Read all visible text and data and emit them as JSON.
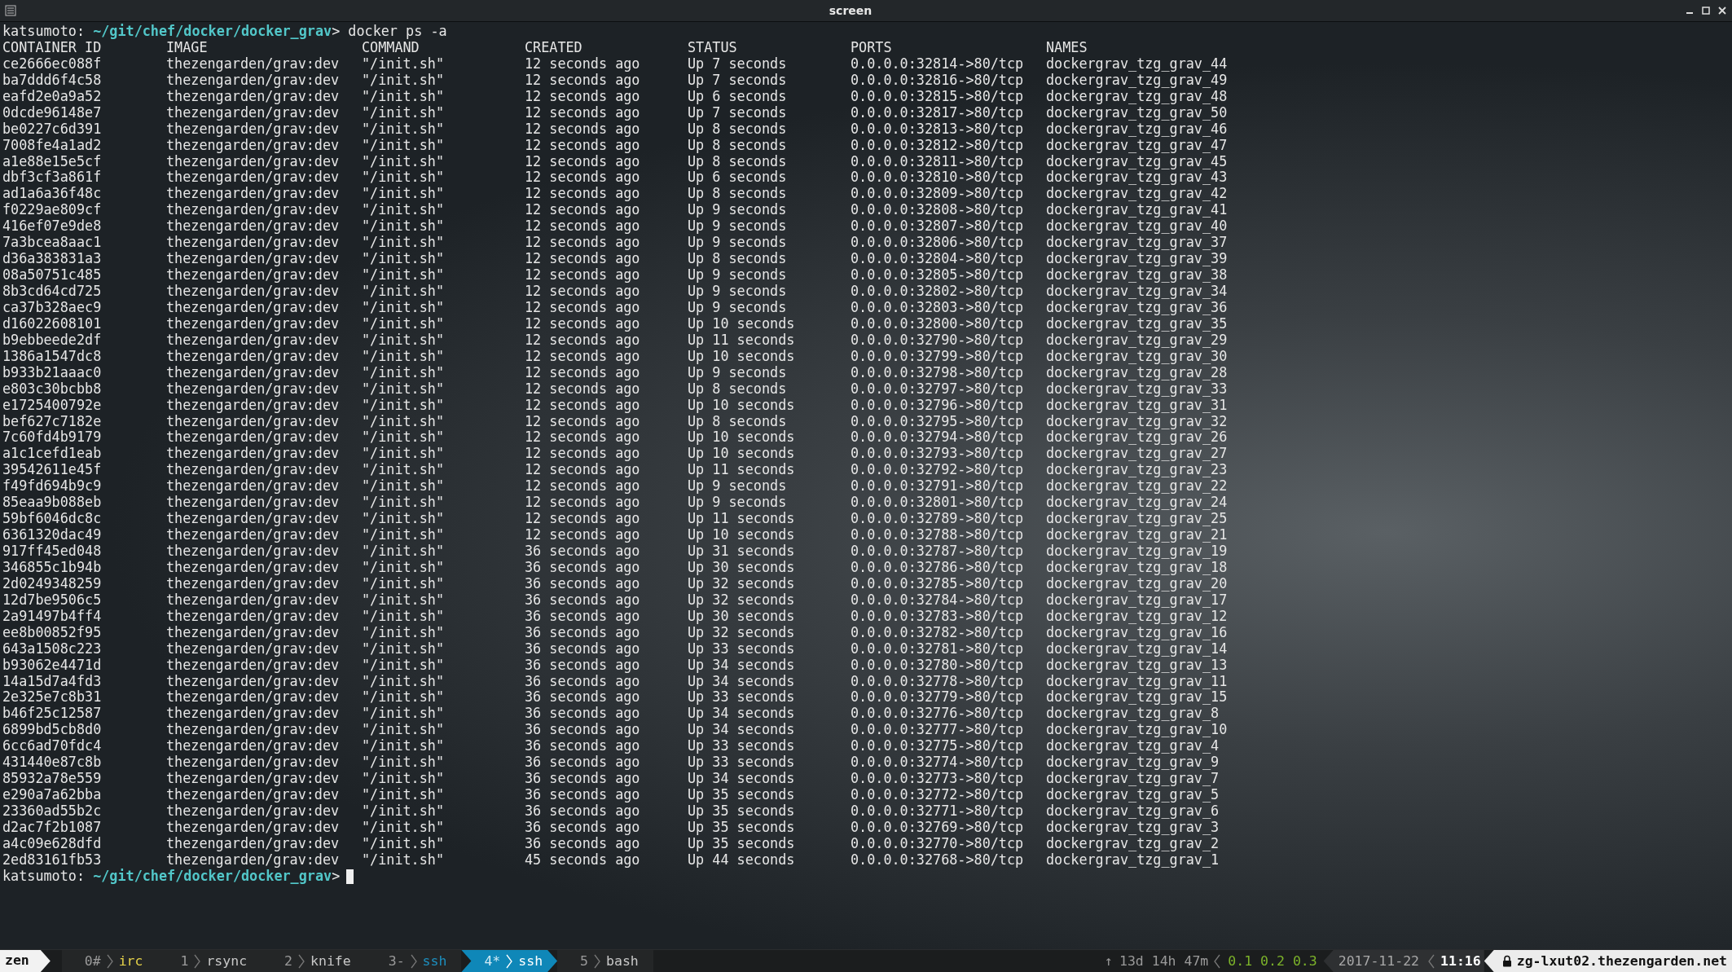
{
  "window": {
    "title": "screen"
  },
  "prompt": {
    "user": "katsumoto:",
    "path": "~/git/chef/docker/docker_grav",
    "symbol": ">",
    "command": "docker ps -a"
  },
  "table": {
    "columns": [
      "CONTAINER ID",
      "IMAGE",
      "COMMAND",
      "CREATED",
      "STATUS",
      "PORTS",
      "NAMES"
    ],
    "rows": [
      [
        "ce2666ec088f",
        "thezengarden/grav:dev",
        "\"/init.sh\"",
        "12 seconds ago",
        "Up 7 seconds",
        "0.0.0.0:32814->80/tcp",
        "dockergrav_tzg_grav_44"
      ],
      [
        "ba7ddd6f4c58",
        "thezengarden/grav:dev",
        "\"/init.sh\"",
        "12 seconds ago",
        "Up 7 seconds",
        "0.0.0.0:32816->80/tcp",
        "dockergrav_tzg_grav_49"
      ],
      [
        "eafd2e0a9a52",
        "thezengarden/grav:dev",
        "\"/init.sh\"",
        "12 seconds ago",
        "Up 6 seconds",
        "0.0.0.0:32815->80/tcp",
        "dockergrav_tzg_grav_48"
      ],
      [
        "0dcde96148e7",
        "thezengarden/grav:dev",
        "\"/init.sh\"",
        "12 seconds ago",
        "Up 7 seconds",
        "0.0.0.0:32817->80/tcp",
        "dockergrav_tzg_grav_50"
      ],
      [
        "be0227c6d391",
        "thezengarden/grav:dev",
        "\"/init.sh\"",
        "12 seconds ago",
        "Up 8 seconds",
        "0.0.0.0:32813->80/tcp",
        "dockergrav_tzg_grav_46"
      ],
      [
        "7008fe4a1ad2",
        "thezengarden/grav:dev",
        "\"/init.sh\"",
        "12 seconds ago",
        "Up 8 seconds",
        "0.0.0.0:32812->80/tcp",
        "dockergrav_tzg_grav_47"
      ],
      [
        "a1e88e15e5cf",
        "thezengarden/grav:dev",
        "\"/init.sh\"",
        "12 seconds ago",
        "Up 8 seconds",
        "0.0.0.0:32811->80/tcp",
        "dockergrav_tzg_grav_45"
      ],
      [
        "dbf3cf3a861f",
        "thezengarden/grav:dev",
        "\"/init.sh\"",
        "12 seconds ago",
        "Up 6 seconds",
        "0.0.0.0:32810->80/tcp",
        "dockergrav_tzg_grav_43"
      ],
      [
        "ad1a6a36f48c",
        "thezengarden/grav:dev",
        "\"/init.sh\"",
        "12 seconds ago",
        "Up 8 seconds",
        "0.0.0.0:32809->80/tcp",
        "dockergrav_tzg_grav_42"
      ],
      [
        "f0229ae809cf",
        "thezengarden/grav:dev",
        "\"/init.sh\"",
        "12 seconds ago",
        "Up 9 seconds",
        "0.0.0.0:32808->80/tcp",
        "dockergrav_tzg_grav_41"
      ],
      [
        "416ef07e9de8",
        "thezengarden/grav:dev",
        "\"/init.sh\"",
        "12 seconds ago",
        "Up 9 seconds",
        "0.0.0.0:32807->80/tcp",
        "dockergrav_tzg_grav_40"
      ],
      [
        "7a3bcea8aac1",
        "thezengarden/grav:dev",
        "\"/init.sh\"",
        "12 seconds ago",
        "Up 9 seconds",
        "0.0.0.0:32806->80/tcp",
        "dockergrav_tzg_grav_37"
      ],
      [
        "d36a383831a3",
        "thezengarden/grav:dev",
        "\"/init.sh\"",
        "12 seconds ago",
        "Up 8 seconds",
        "0.0.0.0:32804->80/tcp",
        "dockergrav_tzg_grav_39"
      ],
      [
        "08a50751c485",
        "thezengarden/grav:dev",
        "\"/init.sh\"",
        "12 seconds ago",
        "Up 9 seconds",
        "0.0.0.0:32805->80/tcp",
        "dockergrav_tzg_grav_38"
      ],
      [
        "8b3cd64cd725",
        "thezengarden/grav:dev",
        "\"/init.sh\"",
        "12 seconds ago",
        "Up 9 seconds",
        "0.0.0.0:32802->80/tcp",
        "dockergrav_tzg_grav_34"
      ],
      [
        "ca37b328aec9",
        "thezengarden/grav:dev",
        "\"/init.sh\"",
        "12 seconds ago",
        "Up 9 seconds",
        "0.0.0.0:32803->80/tcp",
        "dockergrav_tzg_grav_36"
      ],
      [
        "d16022608101",
        "thezengarden/grav:dev",
        "\"/init.sh\"",
        "12 seconds ago",
        "Up 10 seconds",
        "0.0.0.0:32800->80/tcp",
        "dockergrav_tzg_grav_35"
      ],
      [
        "b9ebbeede2df",
        "thezengarden/grav:dev",
        "\"/init.sh\"",
        "12 seconds ago",
        "Up 11 seconds",
        "0.0.0.0:32790->80/tcp",
        "dockergrav_tzg_grav_29"
      ],
      [
        "1386a1547dc8",
        "thezengarden/grav:dev",
        "\"/init.sh\"",
        "12 seconds ago",
        "Up 10 seconds",
        "0.0.0.0:32799->80/tcp",
        "dockergrav_tzg_grav_30"
      ],
      [
        "b933b21aaac0",
        "thezengarden/grav:dev",
        "\"/init.sh\"",
        "12 seconds ago",
        "Up 9 seconds",
        "0.0.0.0:32798->80/tcp",
        "dockergrav_tzg_grav_28"
      ],
      [
        "e803c30bcbb8",
        "thezengarden/grav:dev",
        "\"/init.sh\"",
        "12 seconds ago",
        "Up 8 seconds",
        "0.0.0.0:32797->80/tcp",
        "dockergrav_tzg_grav_33"
      ],
      [
        "e1725400792e",
        "thezengarden/grav:dev",
        "\"/init.sh\"",
        "12 seconds ago",
        "Up 10 seconds",
        "0.0.0.0:32796->80/tcp",
        "dockergrav_tzg_grav_31"
      ],
      [
        "bef627c7182e",
        "thezengarden/grav:dev",
        "\"/init.sh\"",
        "12 seconds ago",
        "Up 8 seconds",
        "0.0.0.0:32795->80/tcp",
        "dockergrav_tzg_grav_32"
      ],
      [
        "7c60fd4b9179",
        "thezengarden/grav:dev",
        "\"/init.sh\"",
        "12 seconds ago",
        "Up 10 seconds",
        "0.0.0.0:32794->80/tcp",
        "dockergrav_tzg_grav_26"
      ],
      [
        "a1c1cefd1eab",
        "thezengarden/grav:dev",
        "\"/init.sh\"",
        "12 seconds ago",
        "Up 10 seconds",
        "0.0.0.0:32793->80/tcp",
        "dockergrav_tzg_grav_27"
      ],
      [
        "39542611e45f",
        "thezengarden/grav:dev",
        "\"/init.sh\"",
        "12 seconds ago",
        "Up 11 seconds",
        "0.0.0.0:32792->80/tcp",
        "dockergrav_tzg_grav_23"
      ],
      [
        "f49fd694b9c9",
        "thezengarden/grav:dev",
        "\"/init.sh\"",
        "12 seconds ago",
        "Up 9 seconds",
        "0.0.0.0:32791->80/tcp",
        "dockergrav_tzg_grav_22"
      ],
      [
        "85eaa9b088eb",
        "thezengarden/grav:dev",
        "\"/init.sh\"",
        "12 seconds ago",
        "Up 9 seconds",
        "0.0.0.0:32801->80/tcp",
        "dockergrav_tzg_grav_24"
      ],
      [
        "59bf6046dc8c",
        "thezengarden/grav:dev",
        "\"/init.sh\"",
        "12 seconds ago",
        "Up 11 seconds",
        "0.0.0.0:32789->80/tcp",
        "dockergrav_tzg_grav_25"
      ],
      [
        "6361320dac49",
        "thezengarden/grav:dev",
        "\"/init.sh\"",
        "12 seconds ago",
        "Up 10 seconds",
        "0.0.0.0:32788->80/tcp",
        "dockergrav_tzg_grav_21"
      ],
      [
        "917ff45ed048",
        "thezengarden/grav:dev",
        "\"/init.sh\"",
        "36 seconds ago",
        "Up 31 seconds",
        "0.0.0.0:32787->80/tcp",
        "dockergrav_tzg_grav_19"
      ],
      [
        "346855c1b94b",
        "thezengarden/grav:dev",
        "\"/init.sh\"",
        "36 seconds ago",
        "Up 30 seconds",
        "0.0.0.0:32786->80/tcp",
        "dockergrav_tzg_grav_18"
      ],
      [
        "2d0249348259",
        "thezengarden/grav:dev",
        "\"/init.sh\"",
        "36 seconds ago",
        "Up 32 seconds",
        "0.0.0.0:32785->80/tcp",
        "dockergrav_tzg_grav_20"
      ],
      [
        "12d7be9506c5",
        "thezengarden/grav:dev",
        "\"/init.sh\"",
        "36 seconds ago",
        "Up 32 seconds",
        "0.0.0.0:32784->80/tcp",
        "dockergrav_tzg_grav_17"
      ],
      [
        "2a91497b4ff4",
        "thezengarden/grav:dev",
        "\"/init.sh\"",
        "36 seconds ago",
        "Up 30 seconds",
        "0.0.0.0:32783->80/tcp",
        "dockergrav_tzg_grav_12"
      ],
      [
        "ee8b00852f95",
        "thezengarden/grav:dev",
        "\"/init.sh\"",
        "36 seconds ago",
        "Up 32 seconds",
        "0.0.0.0:32782->80/tcp",
        "dockergrav_tzg_grav_16"
      ],
      [
        "643a1508c223",
        "thezengarden/grav:dev",
        "\"/init.sh\"",
        "36 seconds ago",
        "Up 33 seconds",
        "0.0.0.0:32781->80/tcp",
        "dockergrav_tzg_grav_14"
      ],
      [
        "b93062e4471d",
        "thezengarden/grav:dev",
        "\"/init.sh\"",
        "36 seconds ago",
        "Up 34 seconds",
        "0.0.0.0:32780->80/tcp",
        "dockergrav_tzg_grav_13"
      ],
      [
        "14a15d7a4fd3",
        "thezengarden/grav:dev",
        "\"/init.sh\"",
        "36 seconds ago",
        "Up 34 seconds",
        "0.0.0.0:32778->80/tcp",
        "dockergrav_tzg_grav_11"
      ],
      [
        "2e325e7c8b31",
        "thezengarden/grav:dev",
        "\"/init.sh\"",
        "36 seconds ago",
        "Up 33 seconds",
        "0.0.0.0:32779->80/tcp",
        "dockergrav_tzg_grav_15"
      ],
      [
        "b46f25c12587",
        "thezengarden/grav:dev",
        "\"/init.sh\"",
        "36 seconds ago",
        "Up 34 seconds",
        "0.0.0.0:32776->80/tcp",
        "dockergrav_tzg_grav_8"
      ],
      [
        "6899bd5cb8d0",
        "thezengarden/grav:dev",
        "\"/init.sh\"",
        "36 seconds ago",
        "Up 34 seconds",
        "0.0.0.0:32777->80/tcp",
        "dockergrav_tzg_grav_10"
      ],
      [
        "6cc6ad70fdc4",
        "thezengarden/grav:dev",
        "\"/init.sh\"",
        "36 seconds ago",
        "Up 33 seconds",
        "0.0.0.0:32775->80/tcp",
        "dockergrav_tzg_grav_4"
      ],
      [
        "431440e87c8b",
        "thezengarden/grav:dev",
        "\"/init.sh\"",
        "36 seconds ago",
        "Up 33 seconds",
        "0.0.0.0:32774->80/tcp",
        "dockergrav_tzg_grav_9"
      ],
      [
        "85932a78e559",
        "thezengarden/grav:dev",
        "\"/init.sh\"",
        "36 seconds ago",
        "Up 34 seconds",
        "0.0.0.0:32773->80/tcp",
        "dockergrav_tzg_grav_7"
      ],
      [
        "e290a7a62bba",
        "thezengarden/grav:dev",
        "\"/init.sh\"",
        "36 seconds ago",
        "Up 35 seconds",
        "0.0.0.0:32772->80/tcp",
        "dockergrav_tzg_grav_5"
      ],
      [
        "23360ad55b2c",
        "thezengarden/grav:dev",
        "\"/init.sh\"",
        "36 seconds ago",
        "Up 35 seconds",
        "0.0.0.0:32771->80/tcp",
        "dockergrav_tzg_grav_6"
      ],
      [
        "d2ac7f2b1087",
        "thezengarden/grav:dev",
        "\"/init.sh\"",
        "36 seconds ago",
        "Up 35 seconds",
        "0.0.0.0:32769->80/tcp",
        "dockergrav_tzg_grav_3"
      ],
      [
        "a4c09e628dfd",
        "thezengarden/grav:dev",
        "\"/init.sh\"",
        "36 seconds ago",
        "Up 35 seconds",
        "0.0.0.0:32770->80/tcp",
        "dockergrav_tzg_grav_2"
      ],
      [
        "2ed83161fb53",
        "thezengarden/grav:dev",
        "\"/init.sh\"",
        "45 seconds ago",
        "Up 44 seconds",
        "0.0.0.0:32768->80/tcp",
        "dockergrav_tzg_grav_1"
      ]
    ]
  },
  "prompt_after": {
    "user": "katsumoto:",
    "path": "~/git/chef/docker/docker_grav",
    "symbol": ">"
  },
  "status_bar": {
    "session": "zen",
    "windows": [
      {
        "number": "0#",
        "name": "irc",
        "selected": false,
        "color": "#e8d44a"
      },
      {
        "number": "1",
        "name": "rsync",
        "selected": false,
        "color": "#c8c8c8"
      },
      {
        "number": "2",
        "name": "knife",
        "selected": false,
        "color": "#c8c8c8"
      },
      {
        "number": "3-",
        "name": "ssh",
        "selected": false,
        "color": "#1d8fbf"
      },
      {
        "number": "4*",
        "name": "ssh",
        "selected": true,
        "color": "#ffffff"
      },
      {
        "number": "5",
        "name": "bash",
        "selected": false,
        "color": "#c8c8c8"
      }
    ],
    "uptime_arrow": "↑",
    "uptime": "13d 14h 47m",
    "load": [
      "0.1",
      "0.2",
      "0.3"
    ],
    "date": "2017-11-22",
    "time": "11:16",
    "host": "zg-lxut02.thezengarden.net"
  }
}
